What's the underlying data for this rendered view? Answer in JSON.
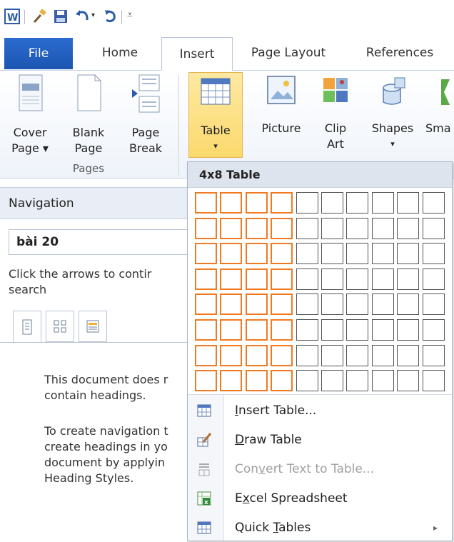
{
  "tabs": {
    "file": "File",
    "home": "Home",
    "insert": "Insert",
    "page_layout": "Page Layout",
    "references": "References"
  },
  "ribbon": {
    "cover_page": {
      "line1": "Cover",
      "line2": "Page ▾"
    },
    "blank_page": {
      "line1": "Blank",
      "line2": "Page"
    },
    "page_break": {
      "line1": "Page",
      "line2": "Break"
    },
    "pages_group": "Pages",
    "table": {
      "line1": "Table",
      "line2": "▾"
    },
    "picture": "Picture",
    "clip_art": {
      "line1": "Clip",
      "line2": "Art"
    },
    "shapes": {
      "line1": "Shapes",
      "line2": "▾"
    },
    "smartart": "Sma"
  },
  "navigation": {
    "title": "Navigation",
    "search_value": "bài 20",
    "hint": [
      "Click the arrows to contir",
      "search"
    ],
    "message1": [
      "This document does r",
      "contain headings."
    ],
    "message2": [
      "To create navigation t",
      "create headings in yo",
      "document by applyin",
      "Heading Styles."
    ]
  },
  "dropdown": {
    "title": "4x8 Table",
    "grid": {
      "columns": 10,
      "rows": 8,
      "selected_columns": 4,
      "selected_rows": 8
    },
    "items": [
      {
        "pre": "",
        "u": "I",
        "post": "nsert Table...",
        "icon": "insert-table-icon",
        "enabled": true
      },
      {
        "pre": "",
        "u": "D",
        "post": "raw Table",
        "icon": "pencil-icon",
        "enabled": true
      },
      {
        "pre": "Con",
        "u": "v",
        "post": "ert Text to Table...",
        "icon": "convert-icon",
        "enabled": false
      },
      {
        "pre": "E",
        "u": "x",
        "post": "cel Spreadsheet",
        "icon": "excel-icon",
        "enabled": true
      },
      {
        "pre": "Quick ",
        "u": "T",
        "post": "ables",
        "icon": "quick-tables-icon",
        "enabled": true,
        "submenu": "▸"
      }
    ]
  },
  "colors": {
    "file_tab": "#2b6bd0",
    "highlight": "#f07a22",
    "table_button": "#fbd96d"
  }
}
